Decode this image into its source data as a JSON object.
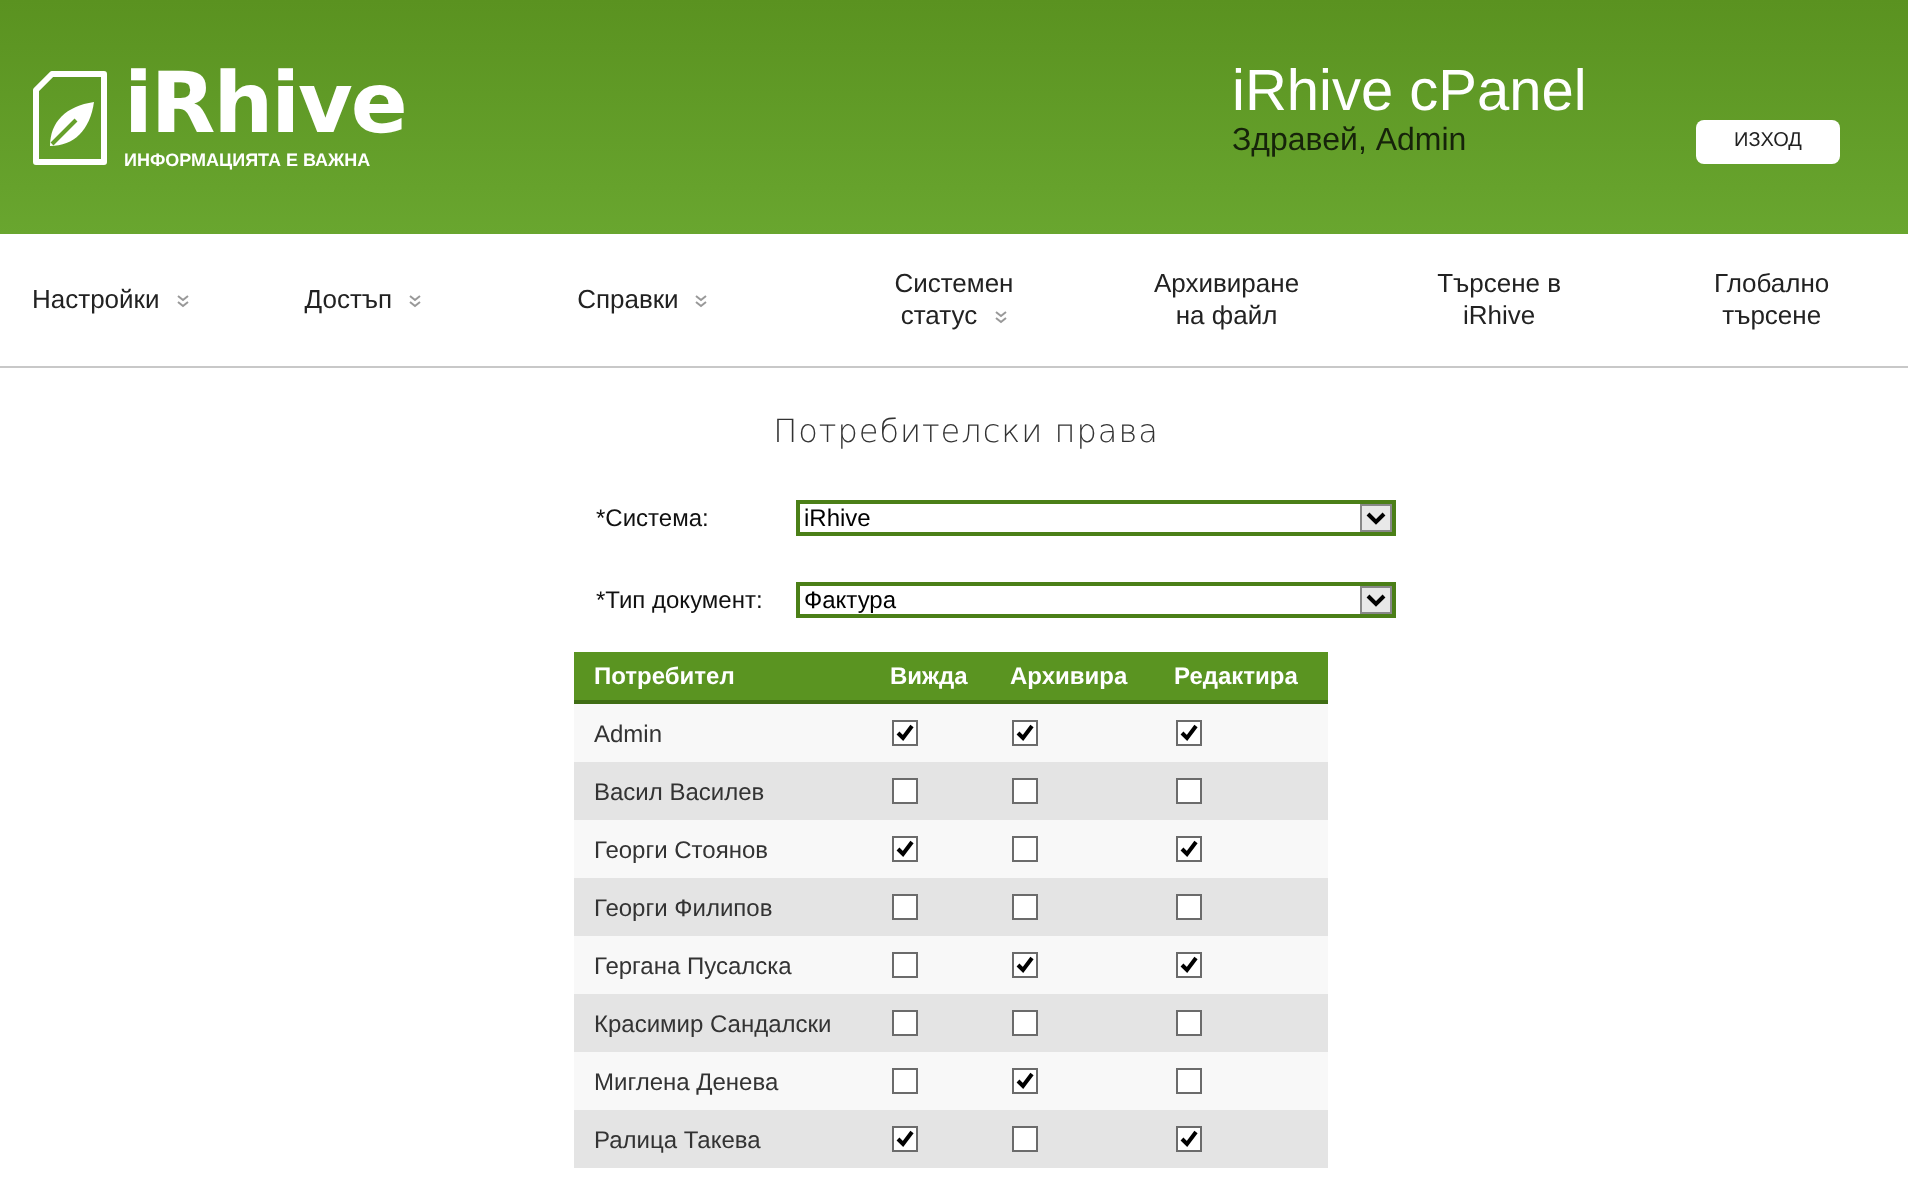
{
  "header": {
    "logo": {
      "name": "iRhive",
      "tagline": "ИНФОРМАЦИЯТА Е ВАЖНА"
    },
    "title": "iRhive cPanel",
    "greeting": "Здравей, Admin",
    "logout_button": "ИЗХОД"
  },
  "nav": [
    {
      "label": "Настройки",
      "has_menu": true
    },
    {
      "label": "Достъп",
      "has_menu": true
    },
    {
      "label": "Справки",
      "has_menu": true
    },
    {
      "label": "Системен статус",
      "has_menu": true
    },
    {
      "label": "Архивиране на файл",
      "has_menu": false
    },
    {
      "label": "Търсене в iRhive",
      "has_menu": false
    },
    {
      "label": "Глобално търсене",
      "has_menu": false
    }
  ],
  "page_title": "Потребителски права",
  "form": [
    {
      "label": "*Система:",
      "value": "iRhive"
    },
    {
      "label": "*Тип документ:",
      "value": "Фактура"
    }
  ],
  "table": {
    "columns": [
      "Потребител",
      "Вижда",
      "Архивира",
      "Редактира"
    ],
    "rows": [
      {
        "user": "Admin",
        "permissions": [
          true,
          true,
          true
        ]
      },
      {
        "user": "Васил Василев",
        "permissions": [
          false,
          false,
          false
        ]
      },
      {
        "user": "Георги Стоянов",
        "permissions": [
          true,
          false,
          true
        ]
      },
      {
        "user": "Георги Филипов",
        "permissions": [
          false,
          false,
          false
        ]
      },
      {
        "user": "Гергана Пусалска",
        "permissions": [
          false,
          true,
          true
        ]
      },
      {
        "user": "Красимир Сандалски",
        "permissions": [
          false,
          false,
          false
        ]
      },
      {
        "user": "Миглена Денева",
        "permissions": [
          false,
          true,
          false
        ]
      },
      {
        "user": "Ралица Такева",
        "permissions": [
          true,
          false,
          true
        ]
      }
    ]
  }
}
